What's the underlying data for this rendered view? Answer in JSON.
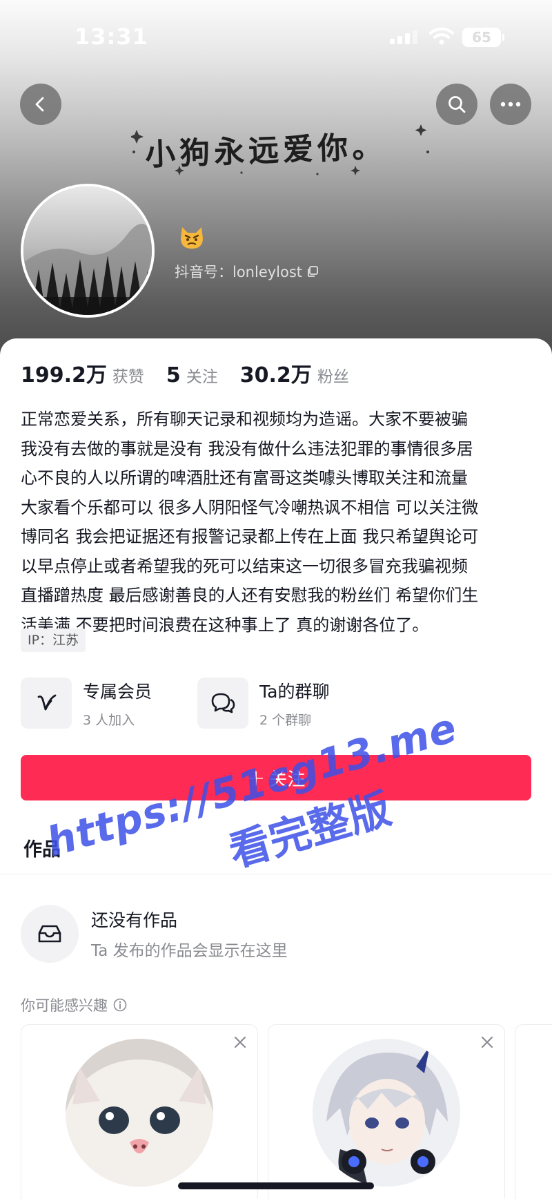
{
  "status_bar": {
    "time": "13:31",
    "battery": "65"
  },
  "header": {
    "banner_text": "小狗永远爱你。",
    "douyin_id": "抖音号：lonleylost"
  },
  "stats": {
    "likes_value": "199.2万",
    "likes_label": "获赞",
    "following_value": "5",
    "following_label": "关注",
    "followers_value": "30.2万",
    "followers_label": "粉丝"
  },
  "bio": {
    "lines": [
      "正常恋爱关系，所有聊天记录和视频均为造谣。大家不要被骗",
      "我没有去做的事就是没有 我没有做什么违法犯罪的事情很多居",
      "心不良的人以所谓的啤酒肚还有富哥这类噱头博取关注和流量",
      "大家看个乐都可以 很多人阴阳怪气冷嘲热讽不相信 可以关注微",
      "博同名 我会把证据还有报警记录都上传在上面 我只希望舆论可",
      "以早点停止或者希望我的死可以结束这一切很多冒充我骗视频",
      "直播蹭热度 最后感谢善良的人还有安慰我的粉丝们 希望你们生",
      "活美满 不要把时间浪费在这种事上了 真的谢谢各位了。"
    ],
    "ip": "IP：江苏"
  },
  "features": {
    "member_title": "专属会员",
    "member_sub": "3 人加入",
    "group_title": "Ta的群聊",
    "group_sub": "2 个群聊"
  },
  "follow_button": {
    "plus": "+",
    "label": "关注"
  },
  "works": {
    "tab_label": "作品",
    "empty_title": "还没有作品",
    "empty_sub": "Ta 发布的作品会显示在这里"
  },
  "recommend": {
    "label": "你可能感兴趣"
  },
  "watermark": {
    "line1": "https://51cg13.me",
    "line2": "看完整版"
  },
  "colors": {
    "accent": "#fe2c55",
    "watermark": "#3c50e6"
  },
  "icons": [
    "back-arrow-icon",
    "search-icon",
    "more-dots-icon",
    "copy-icon",
    "vip-v-icon",
    "group-chat-icon",
    "inbox-icon",
    "info-icon",
    "close-icon"
  ]
}
